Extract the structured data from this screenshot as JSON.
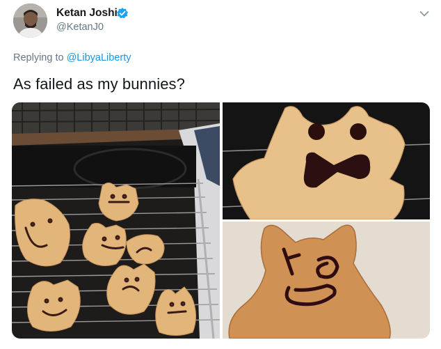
{
  "tweet": {
    "author": {
      "display_name": "Ketan Joshi",
      "handle": "@KetanJ0",
      "verified": true,
      "avatar_icon": "profile-photo"
    },
    "replying_prefix": "Replying to ",
    "replying_to": "@LibyaLiberty",
    "text": "As failed as my bunnies?",
    "menu_icon": "chevron-down-icon",
    "photos_count": 3,
    "colors": {
      "link": "#1b95e0",
      "verified": "#1da1f2",
      "secondary_text": "#657786"
    }
  }
}
